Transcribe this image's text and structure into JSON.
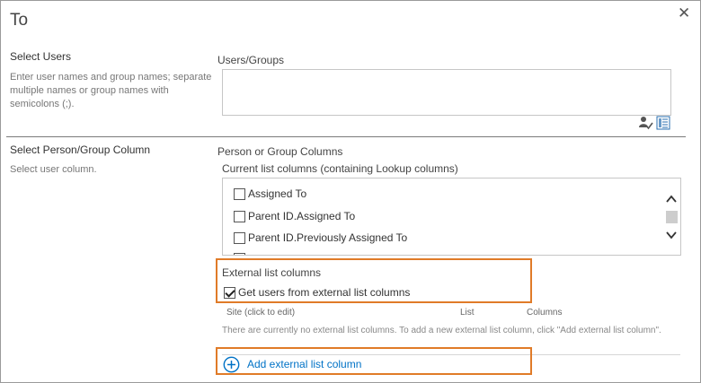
{
  "dialog": {
    "title": "To",
    "close_glyph": "✕"
  },
  "select_users": {
    "title": "Select Users",
    "description": "Enter user names and group names; separate multiple names or group names with semicolons (;).",
    "field_label": "Users/Groups",
    "field_value": "",
    "icons": [
      "check-names-icon",
      "address-book-icon"
    ]
  },
  "select_column": {
    "title": "Select Person/Group Column",
    "description": "Select user column.",
    "heading": "Person or Group Columns",
    "current_label": "Current list columns (containing Lookup columns)",
    "current_items": [
      {
        "label": "Assigned To",
        "checked": false
      },
      {
        "label": "Parent ID.Assigned To",
        "checked": false
      },
      {
        "label": "Parent ID.Previously Assigned To",
        "checked": false
      }
    ],
    "external_label": "External list columns",
    "external_checkbox_label": "Get users from external list columns",
    "external_checkbox_checked": true,
    "table_headers": {
      "site": "Site (click to edit)",
      "list": "List",
      "columns": "Columns"
    },
    "empty_message": "There are currently no external list columns. To add a new external list column, click \"Add external list column\".",
    "add_link": "Add external list column"
  },
  "colors": {
    "highlight": "#e07b28",
    "link": "#0072c6"
  }
}
